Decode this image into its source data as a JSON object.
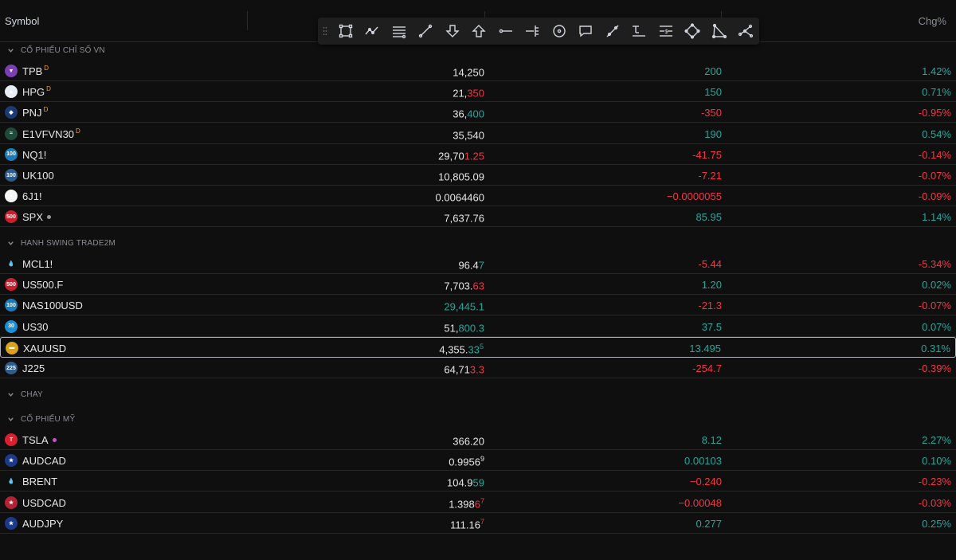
{
  "header": {
    "symbol": "Symbol",
    "chg_pct": "Chg%"
  },
  "toolbar": {
    "tools": [
      "rectangle-icon",
      "path-icon",
      "long-position-icon",
      "trend-line-icon",
      "arrow-down-icon",
      "arrow-up-icon",
      "horizontal-ray-icon",
      "fib-icon",
      "circle-icon",
      "callout-icon",
      "parallel-channel-icon",
      "date-range-icon",
      "price-range-icon",
      "pattern-icon",
      "triangle-icon",
      "polyline-icon"
    ]
  },
  "colors": {
    "up": "#26a69a",
    "down": "#f23645",
    "background": "#0f0f0f"
  },
  "groups": [
    {
      "label": "CỔ PHIẾU CHỈ SỐ VN",
      "rows": [
        {
          "symbol": "TPB",
          "flag": "D",
          "icon": "tpb-logo-icon",
          "icon_text": "▼",
          "icon_color": "#7b3fb4",
          "last_base": "14,250",
          "last_hl": "",
          "last_sup": "",
          "last_color": "wh",
          "chg": "200",
          "chg_color": "up",
          "pct": "1.42%",
          "pct_color": "up"
        },
        {
          "symbol": "HPG",
          "flag": "D",
          "icon": "hpg-logo-icon",
          "icon_text": "▲",
          "icon_color": "#e8eef5",
          "last_base": "21,",
          "last_hl": "350",
          "last_sup": "",
          "last_color": "dn",
          "chg": "150",
          "chg_color": "up",
          "pct": "0.71%",
          "pct_color": "up"
        },
        {
          "symbol": "PNJ",
          "flag": "D",
          "icon": "pnj-logo-icon",
          "icon_text": "◆",
          "icon_color": "#1b3a73",
          "last_base": "36,",
          "last_hl": "400",
          "last_sup": "",
          "last_color": "up",
          "chg": "-350",
          "chg_color": "dn",
          "pct": "-0.95%",
          "pct_color": "dn"
        },
        {
          "symbol": "E1VFVN30",
          "flag": "D",
          "icon": "etf-logo-icon",
          "icon_text": "≈",
          "icon_color": "#1f4a3a",
          "last_base": "35,540",
          "last_hl": "",
          "last_sup": "",
          "last_color": "wh",
          "chg": "190",
          "chg_color": "up",
          "pct": "0.54%",
          "pct_color": "up"
        },
        {
          "symbol": "NQ1!",
          "flag": "",
          "icon": "nq-logo-icon",
          "icon_text": "100",
          "icon_color": "#1a7bb8",
          "last_base": "29,70",
          "last_hl": "1.25",
          "last_sup": "",
          "last_color": "dn",
          "chg": "-41.75",
          "chg_color": "dn",
          "pct": "-0.14%",
          "pct_color": "dn"
        },
        {
          "symbol": "UK100",
          "flag": "",
          "icon": "uk100-logo-icon",
          "icon_text": "100",
          "icon_color": "#2f5c8a",
          "last_base": "10,805.09",
          "last_hl": "",
          "last_sup": "",
          "last_color": "wh",
          "chg": "-7.21",
          "chg_color": "dn",
          "pct": "-0.07%",
          "pct_color": "dn"
        },
        {
          "symbol": "6J1!",
          "flag": "",
          "icon": "jpy-flag-icon",
          "icon_text": "●",
          "icon_color": "#f5f5f5",
          "last_base": "0.0064460",
          "last_hl": "",
          "last_sup": "",
          "last_color": "wh",
          "chg": "−0.0000055",
          "chg_color": "dn",
          "pct": "-0.09%",
          "pct_color": "dn"
        },
        {
          "symbol": "SPX",
          "flag": "",
          "dot": "#9598a1",
          "icon": "spx-logo-icon",
          "icon_text": "500",
          "icon_color": "#c8202f",
          "last_base": "7,637.76",
          "last_hl": "",
          "last_sup": "",
          "last_color": "wh",
          "chg": "85.95",
          "chg_color": "up",
          "pct": "1.14%",
          "pct_color": "up"
        }
      ]
    },
    {
      "label": "HANH SWING TRADE2M",
      "rows": [
        {
          "symbol": "MCL1!",
          "flag": "",
          "icon": "oil-drop-icon",
          "icon_text": "💧",
          "icon_color": "#0f0f0f",
          "last_base": "96.4",
          "last_hl": "7",
          "last_sup": "",
          "last_color": "up",
          "chg": "-5.44",
          "chg_color": "dn",
          "pct": "-5.34%",
          "pct_color": "dn"
        },
        {
          "symbol": "US500.F",
          "flag": "",
          "icon": "us500-logo-icon",
          "icon_text": "500",
          "icon_color": "#c8202f",
          "last_base": "7,703.",
          "last_hl": "63",
          "last_sup": "",
          "last_color": "dn",
          "chg": "1.20",
          "chg_color": "up",
          "pct": "0.02%",
          "pct_color": "up"
        },
        {
          "symbol": "NAS100USD",
          "flag": "",
          "icon": "nas100-logo-icon",
          "icon_text": "100",
          "icon_color": "#1a7bb8",
          "last_base": "",
          "last_hl": "29,445.1",
          "last_sup": "",
          "last_color": "up",
          "chg": "-21.3",
          "chg_color": "dn",
          "pct": "-0.07%",
          "pct_color": "dn"
        },
        {
          "symbol": "US30",
          "flag": "",
          "icon": "us30-logo-icon",
          "icon_text": "30",
          "icon_color": "#1a8fd6",
          "last_base": "51,",
          "last_hl": "800.3",
          "last_sup": "",
          "last_color": "up",
          "chg": "37.5",
          "chg_color": "up",
          "pct": "0.07%",
          "pct_color": "up"
        },
        {
          "symbol": "XAUUSD",
          "flag": "",
          "icon": "gold-icon",
          "icon_text": "▬",
          "icon_color": "#d9a31e",
          "last_base": "4,355.",
          "last_hl": "33",
          "last_sup": "5",
          "last_color": "up",
          "chg": "13.495",
          "chg_color": "up",
          "pct": "0.31%",
          "pct_color": "up",
          "selected": true
        },
        {
          "symbol": "J225",
          "flag": "",
          "icon": "j225-logo-icon",
          "icon_text": "225",
          "icon_color": "#2f5c8a",
          "last_base": "64,71",
          "last_hl": "3.3",
          "last_sup": "",
          "last_color": "dn",
          "chg": "-254.7",
          "chg_color": "dn",
          "pct": "-0.39%",
          "pct_color": "dn"
        }
      ]
    },
    {
      "label": "CHAY",
      "rows": []
    },
    {
      "label": "CỔ PHIẾU MỸ",
      "rows": [
        {
          "symbol": "TSLA",
          "flag": "",
          "dot": "#c054c8",
          "icon": "tesla-logo-icon",
          "icon_text": "T",
          "icon_color": "#d8202f",
          "last_base": "366.20",
          "last_hl": "",
          "last_sup": "",
          "last_color": "wh",
          "chg": "8.12",
          "chg_color": "up",
          "pct": "2.27%",
          "pct_color": "up"
        },
        {
          "symbol": "AUDCAD",
          "flag": "",
          "icon": "aud-cad-flag-icon",
          "icon_text": "★",
          "icon_color": "#1b3a8a",
          "last_base": "0.995",
          "last_hl": "6",
          "last_sup": "9",
          "last_color": "wh",
          "chg": "0.00103",
          "chg_color": "up",
          "pct": "0.10%",
          "pct_color": "up"
        },
        {
          "symbol": "BRENT",
          "flag": "",
          "icon": "oil-drop-icon",
          "icon_text": "💧",
          "icon_color": "#0f0f0f",
          "last_base": "104.9",
          "last_hl": "59",
          "last_sup": "",
          "last_color": "up",
          "chg": "−0.240",
          "chg_color": "dn",
          "pct": "-0.23%",
          "pct_color": "dn"
        },
        {
          "symbol": "USDCAD",
          "flag": "",
          "icon": "usd-cad-flag-icon",
          "icon_text": "★",
          "icon_color": "#b22234",
          "last_base": "1.398",
          "last_hl": "6",
          "last_sup": "7",
          "last_color": "dn",
          "chg": "−0.00048",
          "chg_color": "dn",
          "pct": "-0.03%",
          "pct_color": "dn"
        },
        {
          "symbol": "AUDJPY",
          "flag": "",
          "icon": "aud-jpy-flag-icon",
          "icon_text": "★",
          "icon_color": "#1b3a8a",
          "last_base": "111.16",
          "last_hl": "",
          "last_sup": "7",
          "last_color": "dn",
          "chg": "0.277",
          "chg_color": "up",
          "pct": "0.25%",
          "pct_color": "up"
        }
      ]
    }
  ]
}
